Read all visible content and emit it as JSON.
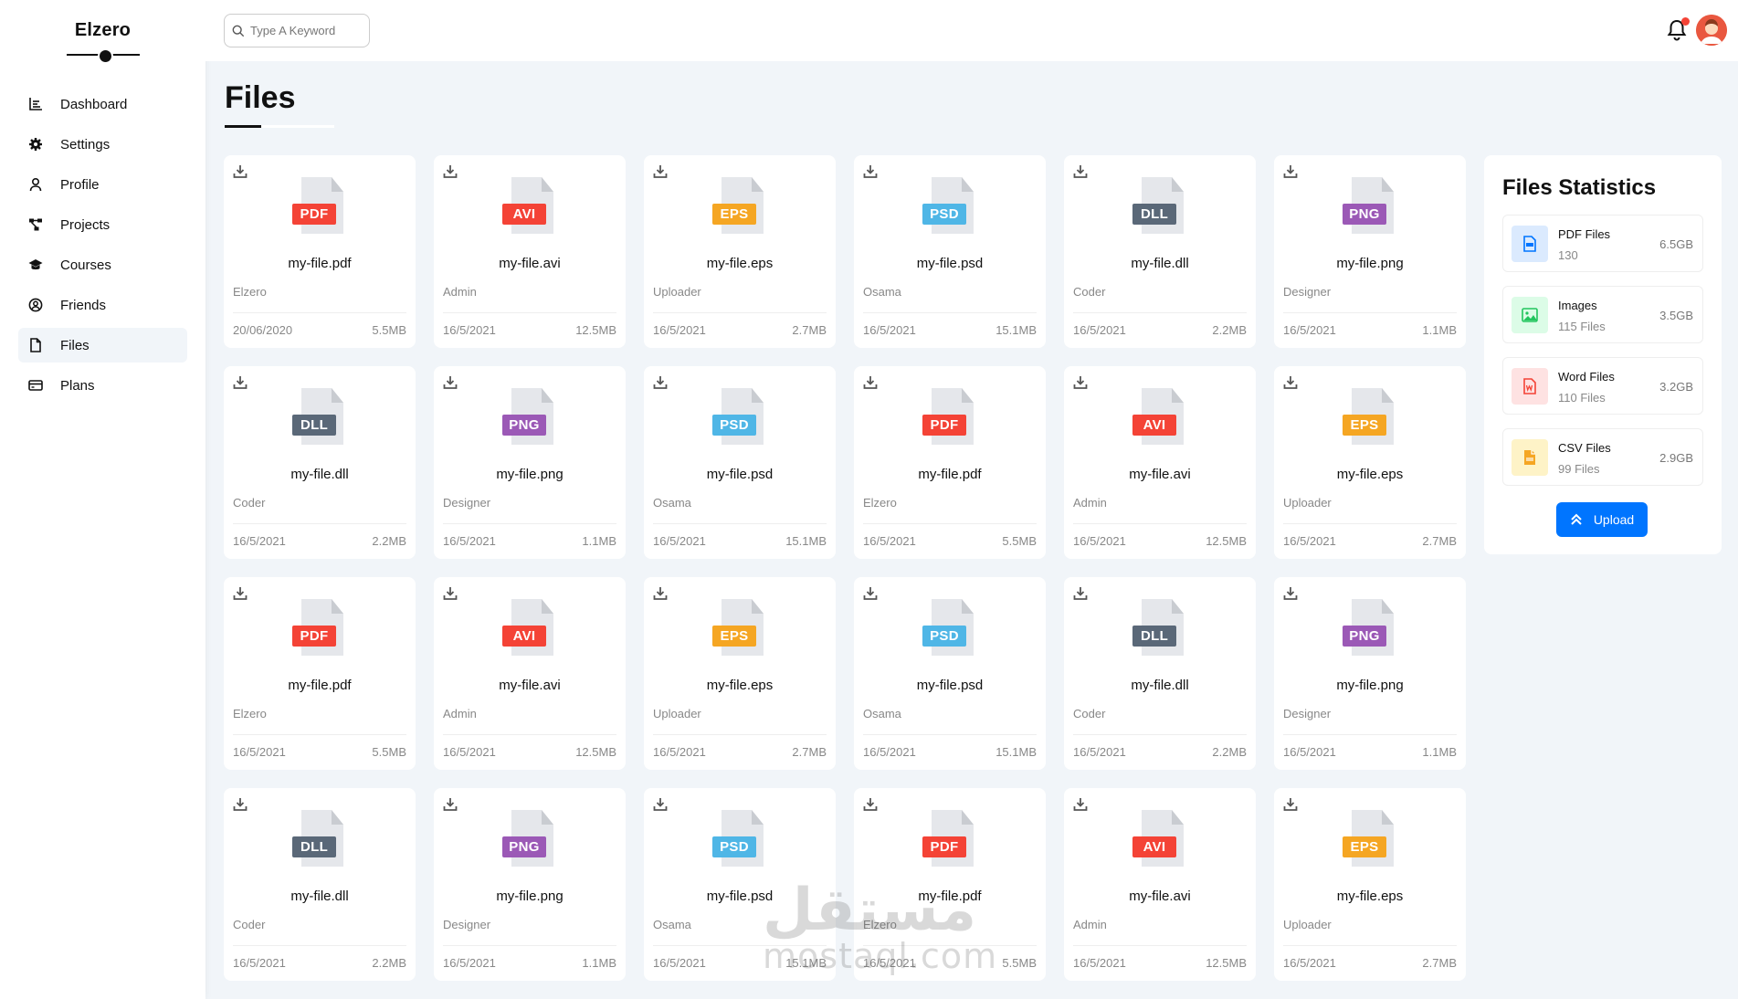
{
  "brand": "Elzero",
  "nav": [
    {
      "label": "Dashboard",
      "icon": "chart-icon"
    },
    {
      "label": "Settings",
      "icon": "gear-icon"
    },
    {
      "label": "Profile",
      "icon": "user-icon"
    },
    {
      "label": "Projects",
      "icon": "diagram-icon"
    },
    {
      "label": "Courses",
      "icon": "graduation-cap-icon"
    },
    {
      "label": "Friends",
      "icon": "user-circle-icon"
    },
    {
      "label": "Files",
      "icon": "file-icon",
      "active": true
    },
    {
      "label": "Plans",
      "icon": "credit-card-icon"
    }
  ],
  "search": {
    "placeholder": "Type A Keyword"
  },
  "page_title": "Files",
  "files": [
    {
      "type": "PDF",
      "name": "my-file.pdf",
      "owner": "Elzero",
      "date": "20/06/2020",
      "size": "5.5MB"
    },
    {
      "type": "AVI",
      "name": "my-file.avi",
      "owner": "Admin",
      "date": "16/5/2021",
      "size": "12.5MB"
    },
    {
      "type": "EPS",
      "name": "my-file.eps",
      "owner": "Uploader",
      "date": "16/5/2021",
      "size": "2.7MB"
    },
    {
      "type": "PSD",
      "name": "my-file.psd",
      "owner": "Osama",
      "date": "16/5/2021",
      "size": "15.1MB"
    },
    {
      "type": "DLL",
      "name": "my-file.dll",
      "owner": "Coder",
      "date": "16/5/2021",
      "size": "2.2MB"
    },
    {
      "type": "PNG",
      "name": "my-file.png",
      "owner": "Designer",
      "date": "16/5/2021",
      "size": "1.1MB"
    },
    {
      "type": "DLL",
      "name": "my-file.dll",
      "owner": "Coder",
      "date": "16/5/2021",
      "size": "2.2MB"
    },
    {
      "type": "PNG",
      "name": "my-file.png",
      "owner": "Designer",
      "date": "16/5/2021",
      "size": "1.1MB"
    },
    {
      "type": "PSD",
      "name": "my-file.psd",
      "owner": "Osama",
      "date": "16/5/2021",
      "size": "15.1MB"
    },
    {
      "type": "PDF",
      "name": "my-file.pdf",
      "owner": "Elzero",
      "date": "16/5/2021",
      "size": "5.5MB"
    },
    {
      "type": "AVI",
      "name": "my-file.avi",
      "owner": "Admin",
      "date": "16/5/2021",
      "size": "12.5MB"
    },
    {
      "type": "EPS",
      "name": "my-file.eps",
      "owner": "Uploader",
      "date": "16/5/2021",
      "size": "2.7MB"
    },
    {
      "type": "PDF",
      "name": "my-file.pdf",
      "owner": "Elzero",
      "date": "16/5/2021",
      "size": "5.5MB"
    },
    {
      "type": "AVI",
      "name": "my-file.avi",
      "owner": "Admin",
      "date": "16/5/2021",
      "size": "12.5MB"
    },
    {
      "type": "EPS",
      "name": "my-file.eps",
      "owner": "Uploader",
      "date": "16/5/2021",
      "size": "2.7MB"
    },
    {
      "type": "PSD",
      "name": "my-file.psd",
      "owner": "Osama",
      "date": "16/5/2021",
      "size": "15.1MB"
    },
    {
      "type": "DLL",
      "name": "my-file.dll",
      "owner": "Coder",
      "date": "16/5/2021",
      "size": "2.2MB"
    },
    {
      "type": "PNG",
      "name": "my-file.png",
      "owner": "Designer",
      "date": "16/5/2021",
      "size": "1.1MB"
    },
    {
      "type": "DLL",
      "name": "my-file.dll",
      "owner": "Coder",
      "date": "16/5/2021",
      "size": "2.2MB"
    },
    {
      "type": "PNG",
      "name": "my-file.png",
      "owner": "Designer",
      "date": "16/5/2021",
      "size": "1.1MB"
    },
    {
      "type": "PSD",
      "name": "my-file.psd",
      "owner": "Osama",
      "date": "16/5/2021",
      "size": "15.1MB"
    },
    {
      "type": "PDF",
      "name": "my-file.pdf",
      "owner": "Elzero",
      "date": "16/5/2021",
      "size": "5.5MB"
    },
    {
      "type": "AVI",
      "name": "my-file.avi",
      "owner": "Admin",
      "date": "16/5/2021",
      "size": "12.5MB"
    },
    {
      "type": "EPS",
      "name": "my-file.eps",
      "owner": "Uploader",
      "date": "16/5/2021",
      "size": "2.7MB"
    }
  ],
  "type_colors": {
    "PDF": "#f44336",
    "AVI": "#f44336",
    "EPS": "#f5a623",
    "PSD": "#4fb6e6",
    "DLL": "#5a6878",
    "PNG": "#9b59b6"
  },
  "stats": {
    "title": "Files Statistics",
    "items": [
      {
        "name": "PDF Files",
        "count": "130",
        "size": "6.5GB",
        "icon": "pdf-file-icon",
        "bg": "#dbeafe",
        "color": "#0075ff"
      },
      {
        "name": "Images",
        "count": "115 Files",
        "size": "3.5GB",
        "icon": "image-icon",
        "bg": "#dcfce7",
        "color": "#22c55e"
      },
      {
        "name": "Word Files",
        "count": "110 Files",
        "size": "3.2GB",
        "icon": "word-file-icon",
        "bg": "#fee2e2",
        "color": "#f44336"
      },
      {
        "name": "CSV Files",
        "count": "99 Files",
        "size": "2.9GB",
        "icon": "csv-file-icon",
        "bg": "#fef3c7",
        "color": "#f5a623"
      }
    ],
    "upload_label": "Upload"
  },
  "watermark": {
    "text": "mostaql.com",
    "glyph": "مستقل"
  }
}
